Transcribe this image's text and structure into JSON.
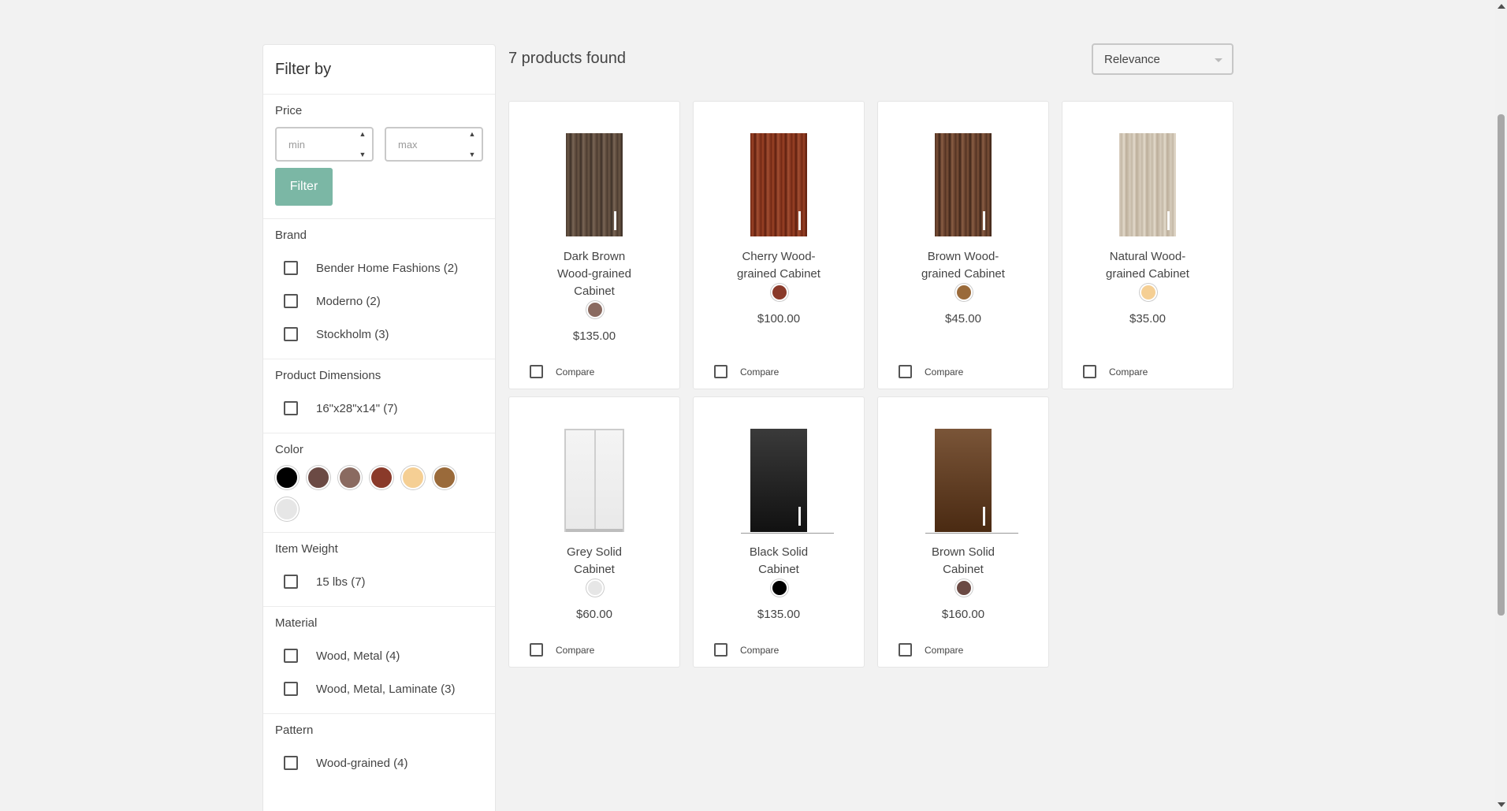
{
  "sidebar": {
    "title": "Filter by",
    "price": {
      "title": "Price",
      "min_placeholder": "min",
      "max_placeholder": "max",
      "filter_label": "Filter"
    },
    "brand": {
      "title": "Brand",
      "items": [
        "Bender Home Fashions (2)",
        "Moderno (2)",
        "Stockholm (3)"
      ]
    },
    "dimensions": {
      "title": "Product Dimensions",
      "items": [
        "16\"x28\"x14\" (7)"
      ]
    },
    "color": {
      "title": "Color",
      "swatches": [
        "#000000",
        "#6b4a44",
        "#8a6a60",
        "#8a3a2a",
        "#f5cf94",
        "#9a6a3a",
        "#e6e6e6"
      ]
    },
    "weight": {
      "title": "Item Weight",
      "items": [
        "15 lbs (7)"
      ]
    },
    "material": {
      "title": "Material",
      "items": [
        "Wood, Metal (4)",
        "Wood, Metal, Laminate (3)"
      ]
    },
    "pattern": {
      "title": "Pattern",
      "items": [
        "Wood-grained (4)"
      ]
    }
  },
  "results": {
    "count_text": "7 products found",
    "sort_value": "Relevance"
  },
  "products": [
    {
      "name": "Dark Brown Wood-grained Cabinet",
      "price": "$135.00",
      "color": "#8a6a60",
      "image": "dark-brown-wood-cabinet",
      "compare": "Compare"
    },
    {
      "name": "Cherry Wood-grained Cabinet",
      "price": "$100.00",
      "color": "#8a3a2a",
      "image": "cherry-wood-cabinet",
      "compare": "Compare"
    },
    {
      "name": "Brown Wood-grained Cabinet",
      "price": "$45.00",
      "color": "#9a6a3a",
      "image": "brown-wood-cabinet",
      "compare": "Compare"
    },
    {
      "name": "Natural Wood-grained Cabinet",
      "price": "$35.00",
      "color": "#f5cf94",
      "image": "natural-wood-cabinet",
      "compare": "Compare"
    },
    {
      "name": "Grey Solid Cabinet",
      "price": "$60.00",
      "color": "#e6e6e6",
      "image": "grey-solid-cabinet",
      "compare": "Compare"
    },
    {
      "name": "Black Solid Cabinet",
      "price": "$135.00",
      "color": "#000000",
      "image": "black-solid-cabinet",
      "compare": "Compare"
    },
    {
      "name": "Brown Solid Cabinet",
      "price": "$160.00",
      "color": "#6b4a44",
      "image": "brown-solid-cabinet",
      "compare": "Compare"
    }
  ]
}
